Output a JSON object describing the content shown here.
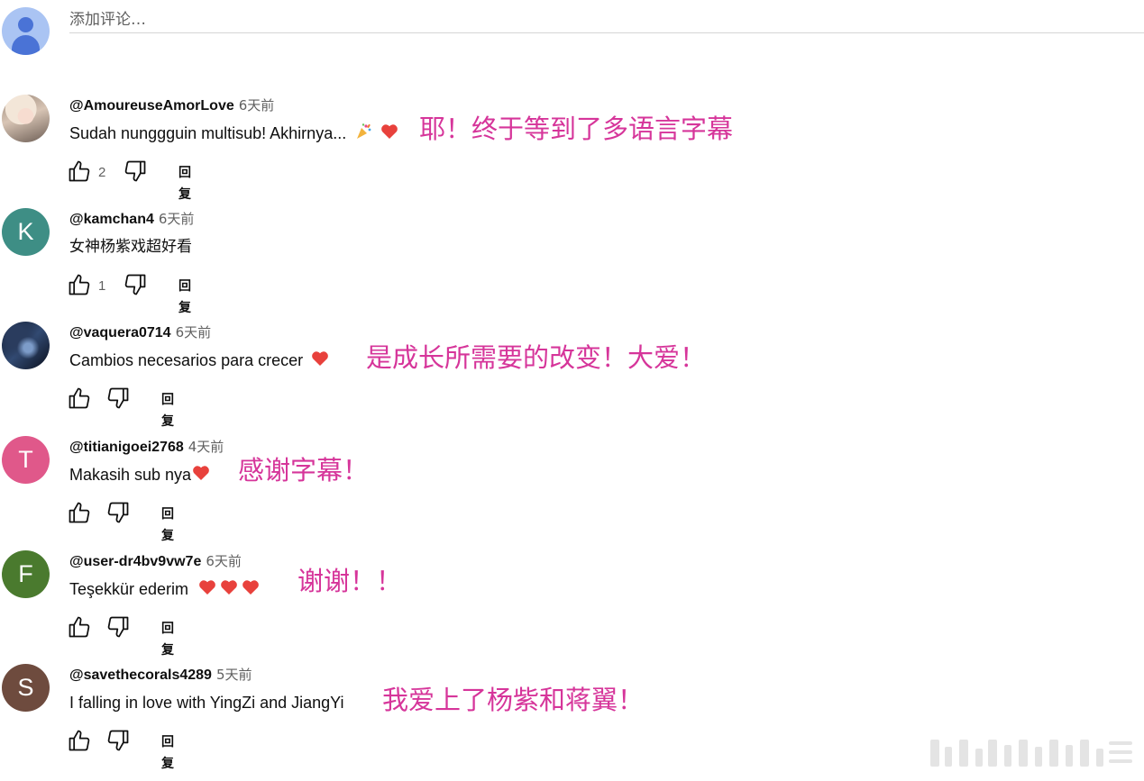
{
  "add_comment": {
    "placeholder": "添加评论…"
  },
  "comments": [
    {
      "handle": "@AmoureuseAmorLove",
      "time": "6天前",
      "text": "Sudah nunggguin multisub! Akhirnya...",
      "emoji": [
        "party-popper-icon",
        "red-heart-icon"
      ],
      "overlay": "耶！终于等到了多语言字幕",
      "likes": "2",
      "avatar_type": "photo",
      "reply_label": "回复"
    },
    {
      "handle": "@kamchan4",
      "time": "6天前",
      "text": "女神杨紫戏超好看",
      "emoji": [],
      "overlay": "",
      "likes": "1",
      "avatar_letter": "K",
      "avatar_color": "#3e8e85",
      "reply_label": "回复"
    },
    {
      "handle": "@vaquera0714",
      "time": "6天前",
      "text": "Cambios necesarios para crecer",
      "emoji": [
        "red-heart-icon"
      ],
      "overlay": "是成长所需要的改变！大爱！",
      "likes": "",
      "avatar_type": "photo",
      "reply_label": "回复"
    },
    {
      "handle": "@titianigoei2768",
      "time": "4天前",
      "text": "Makasih sub nya",
      "emoji": [
        "red-heart-icon"
      ],
      "overlay": "感谢字幕！",
      "likes": "",
      "avatar_letter": "T",
      "avatar_color": "#e0588a",
      "reply_label": "回复"
    },
    {
      "handle": "@user-dr4bv9vw7e",
      "time": "6天前",
      "text": "Teşekkür ederim",
      "emoji": [
        "red-heart-icon",
        "red-heart-icon",
        "red-heart-icon"
      ],
      "overlay": "谢谢！！",
      "likes": "",
      "avatar_letter": "F",
      "avatar_color": "#4a7a2e",
      "reply_label": "回复"
    },
    {
      "handle": "@savethecorals4289",
      "time": "5天前",
      "text": "I falling in love with YingZi and JiangYi",
      "emoji": [],
      "overlay": "我爱上了杨紫和蒋翼！",
      "likes": "",
      "avatar_letter": "S",
      "avatar_color": "#6e4b3e",
      "reply_label": "回复"
    }
  ],
  "colors": {
    "overlay_text": "#d6359a",
    "secondary_text": "#606060",
    "heart": "#e8413c"
  }
}
